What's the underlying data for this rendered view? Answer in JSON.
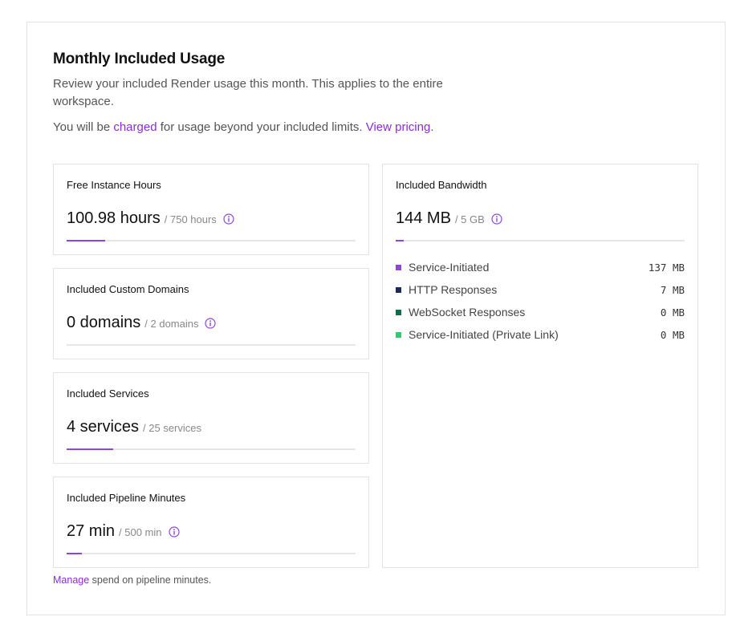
{
  "header": {
    "title": "Monthly Included Usage",
    "description": "Review your included Render usage this month. This applies to the entire workspace.",
    "charge_prefix": "You will be ",
    "charge_link": "charged",
    "charge_middle": " for usage beyond your included limits. ",
    "pricing_link": "View pricing",
    "charge_suffix": "."
  },
  "cards": {
    "instance_hours": {
      "label": "Free Instance Hours",
      "value": "100.98 hours",
      "limit": "/ 750 hours",
      "progress": 0.1346,
      "icon": "info-icon"
    },
    "custom_domains": {
      "label": "Included Custom Domains",
      "value": "0 domains",
      "limit": "/ 2 domains",
      "progress": 0,
      "icon": "info-icon"
    },
    "services": {
      "label": "Included Services",
      "value": "4 services",
      "limit": "/ 25 services",
      "progress": 0.16
    },
    "pipeline_minutes": {
      "label": "Included Pipeline Minutes",
      "value": "27 min",
      "limit": "/ 500 min",
      "progress": 0.054,
      "icon": "info-icon"
    }
  },
  "bandwidth": {
    "label": "Included Bandwidth",
    "value": "144 MB",
    "limit": "/ 5 GB",
    "progress": 0.028,
    "icon": "info-icon",
    "items": [
      {
        "label": "Service-Initiated",
        "value": "137 MB",
        "color": "#8e44dd"
      },
      {
        "label": "HTTP Responses",
        "value": "7 MB",
        "color": "#1a2a5e"
      },
      {
        "label": "WebSocket Responses",
        "value": "0 MB",
        "color": "#0f6b4a"
      },
      {
        "label": "Service-Initiated (Private Link)",
        "value": "0 MB",
        "color": "#2ecc71"
      }
    ]
  },
  "footer": {
    "manage_link": "Manage",
    "manage_text": " spend on pipeline minutes."
  }
}
